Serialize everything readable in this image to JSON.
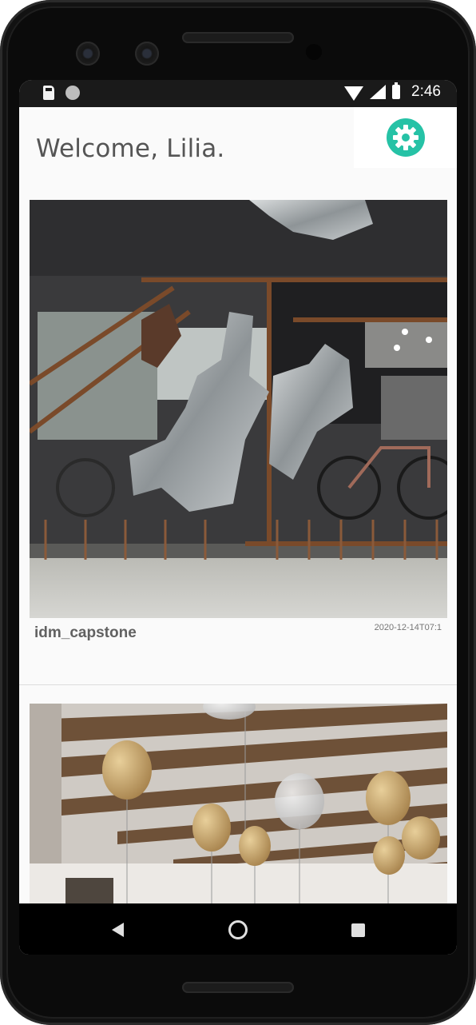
{
  "status_bar": {
    "time": "2:46",
    "icons": [
      "sd-card-icon",
      "sync-circle-icon",
      "wifi-icon",
      "signal-icon",
      "battery-icon"
    ]
  },
  "header": {
    "welcome_text": "Welcome, Lilia.",
    "settings_icon": "gear-icon",
    "accent_color": "#26c2a6"
  },
  "feed": {
    "posts": [
      {
        "image_icon": "photo-metal-mural",
        "username": "idm_capstone",
        "timestamp": "2020-12-14T07:1"
      },
      {
        "image_icon": "photo-balloons-ceiling"
      }
    ]
  },
  "nav_bar": {
    "back_icon": "back-icon",
    "home_icon": "home-icon",
    "recent_icon": "recent-apps-icon"
  }
}
